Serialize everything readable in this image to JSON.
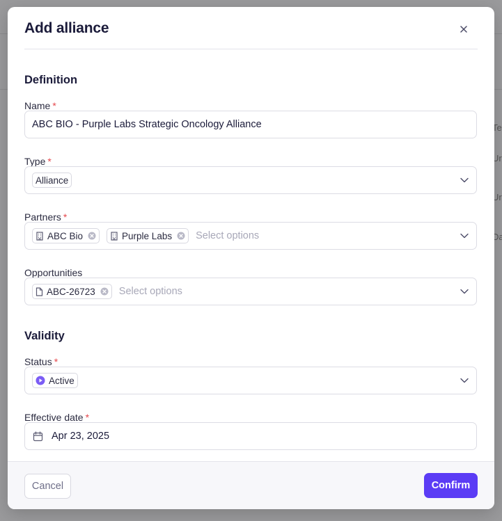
{
  "background": {
    "fragments": [
      "Ter",
      "Ur",
      "Ur",
      "Da"
    ]
  },
  "modal": {
    "title": "Add alliance",
    "close_icon": "close-icon"
  },
  "definition": {
    "section_title": "Definition",
    "name": {
      "label": "Name",
      "required": "*",
      "value": "ABC BIO - Purple Labs Strategic Oncology Alliance"
    },
    "type": {
      "label": "Type",
      "required": "*",
      "value": "Alliance"
    },
    "partners": {
      "label": "Partners",
      "required": "*",
      "chips": [
        "ABC Bio",
        "Purple Labs"
      ],
      "chip_icon": "building-icon",
      "placeholder": "Select options"
    },
    "opportunities": {
      "label": "Opportunities",
      "chips": [
        "ABC-26723"
      ],
      "chip_icon": "document-icon",
      "placeholder": "Select options"
    }
  },
  "validity": {
    "section_title": "Validity",
    "status": {
      "label": "Status",
      "required": "*",
      "value": "Active",
      "icon": "play-circle-icon",
      "color": "#7b5cf5"
    },
    "effective_date": {
      "label": "Effective date",
      "required": "*",
      "value": "Apr 23, 2025",
      "icon": "calendar-icon"
    }
  },
  "footer": {
    "cancel_label": "Cancel",
    "confirm_label": "Confirm"
  },
  "colors": {
    "accent": "#5b3cf5",
    "required": "#e5484d",
    "title": "#1b1b3a"
  }
}
